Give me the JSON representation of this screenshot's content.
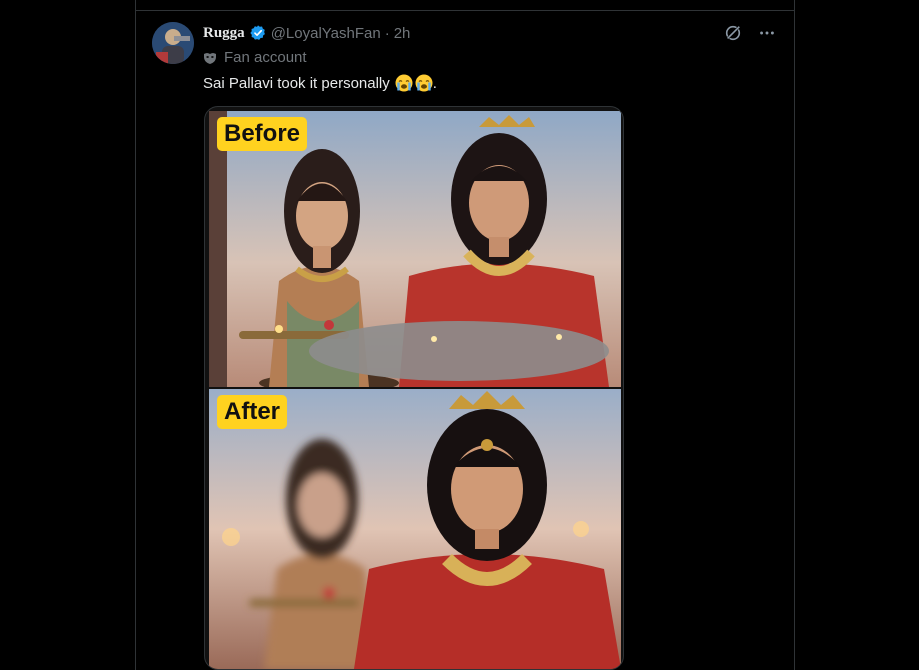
{
  "tweet": {
    "display_name": "Rugga",
    "handle": "@LoyalYashFan",
    "separator": "·",
    "time": "2h",
    "fan_label": "Fan account",
    "text": "Sai Pallavi took it personally",
    "text_suffix": "."
  },
  "media": {
    "before_label": "Before",
    "after_label": "After"
  },
  "colors": {
    "background": "#000000",
    "border": "#2f3336",
    "verified": "#1d9bf0",
    "muted": "#71767b",
    "badge": "#ffd21f"
  },
  "icons": {
    "verified": "verified-badge-icon",
    "grok": "grok-icon",
    "more": "more-icon",
    "fan": "mask-icon",
    "emoji": "loudly-crying-face"
  }
}
